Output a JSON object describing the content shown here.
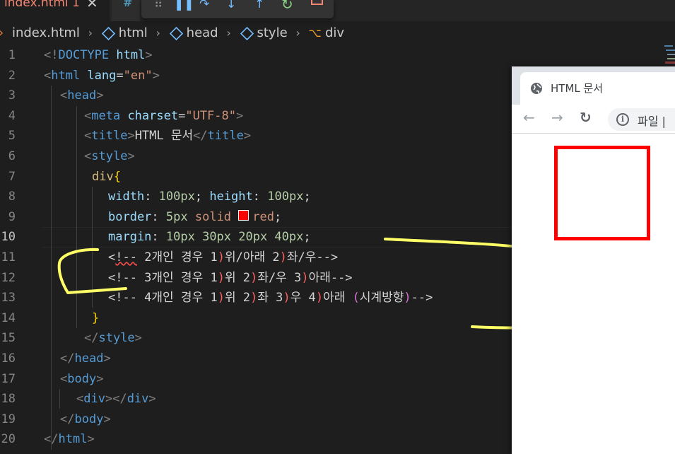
{
  "tab": {
    "filename": "index.html",
    "problems": "1",
    "close": "✕"
  },
  "tab2": {
    "label": "#"
  },
  "breadcrumb": [
    {
      "label": "index.html",
      "icon": "html-file-icon"
    },
    {
      "label": "html",
      "icon": "symbol-element-icon"
    },
    {
      "label": "head",
      "icon": "symbol-element-icon"
    },
    {
      "label": "style",
      "icon": "symbol-element-icon"
    },
    {
      "label": "div",
      "icon": "symbol-selector-icon"
    }
  ],
  "editor": {
    "active_line": 10,
    "line_numbers": [
      "1",
      "2",
      "3",
      "4",
      "5",
      "6",
      "7",
      "8",
      "9",
      "10",
      "11",
      "12",
      "13",
      "14",
      "15",
      "16",
      "17",
      "18",
      "19",
      "20"
    ],
    "lines": {
      "l1": {
        "p1": "<!",
        "p2": "DOCTYPE",
        "p3": " html",
        "p4": ">"
      },
      "l2": {
        "p1": "<",
        "p2": "html",
        "p3": " lang",
        "p4": "=",
        "p5": "\"en\"",
        "p6": ">"
      },
      "l3": {
        "p1": "<",
        "p2": "head",
        "p3": ">"
      },
      "l4": {
        "p1": "<",
        "p2": "meta",
        "p3": " charset",
        "p4": "=",
        "p5": "\"UTF-8\"",
        "p6": ">"
      },
      "l5": {
        "p1": "<",
        "p2": "title",
        "p3": ">",
        "p4": "HTML 문서",
        "p5": "</",
        "p6": "title",
        "p7": ">"
      },
      "l6": {
        "p1": "<",
        "p2": "style",
        "p3": ">"
      },
      "l7": {
        "p1": "div",
        "p2": "{"
      },
      "l8": {
        "p1": "width",
        "p2": ": ",
        "p3": "100px",
        "p4": "; ",
        "p5": "height",
        "p6": ": ",
        "p7": "100px",
        "p8": ";"
      },
      "l9": {
        "p1": "border",
        "p2": ": ",
        "p3": "5px",
        "p4": " solid ",
        "p5": "red",
        "p6": ";"
      },
      "l10": {
        "p1": "margin",
        "p2": ": ",
        "p3": "10px 30px 20px 40px",
        "p4": ";"
      },
      "l11": {
        "p1": "<",
        "p2": "!--",
        "p3": " 2개인 경우 1",
        "p4": ")",
        "p5": "위/아래 2",
        "p6": ")",
        "p7": "좌/우-->"
      },
      "l12": {
        "p1": "<!-- 3개인 경우 1",
        "p2": ")",
        "p3": "위 2",
        "p4": ")",
        "p5": "좌/우 3",
        "p6": ")",
        "p7": "아래-->"
      },
      "l13": {
        "p1": "<!-- 4개인 경우 1",
        "p2": ")",
        "p3": "위 2",
        "p4": ")",
        "p5": "좌 3",
        "p6": ")",
        "p7": "우 4",
        "p8": ")",
        "p9": "아래 ",
        "p10": "(",
        "p11": "시계방향",
        "p12": ")",
        "p13": "-->"
      },
      "l14": {
        "p1": "}"
      },
      "l15": {
        "p1": "</",
        "p2": "style",
        "p3": ">"
      },
      "l16": {
        "p1": "</",
        "p2": "head",
        "p3": ">"
      },
      "l17": {
        "p1": "<",
        "p2": "body",
        "p3": ">"
      },
      "l18": {
        "p1": "<",
        "p2": "div",
        "p3": "></",
        "p4": "div",
        "p5": ">"
      },
      "l19": {
        "p1": "</",
        "p2": "body",
        "p3": ">"
      },
      "l20": {
        "p1": "</",
        "p2": "html",
        "p3": ">"
      }
    }
  },
  "browser": {
    "tab_title": "HTML 문서",
    "back": "←",
    "forward": "→",
    "reload": "↻",
    "omnibox_text": "파일 |",
    "info_icon": "i",
    "demo_border_color": "#ff0000"
  },
  "colors": {
    "editor_bg": "#1e1e1e",
    "annotation": "#ffff66",
    "tab_error_text": "#f48771"
  }
}
